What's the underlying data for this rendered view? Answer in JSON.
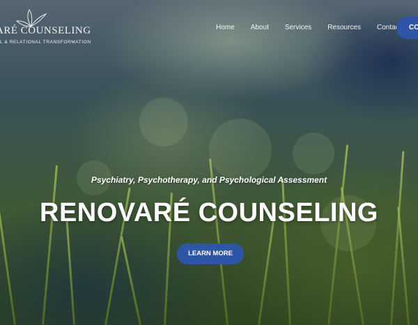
{
  "brand": {
    "name": "RENOVARÉ COUNSELING",
    "logo_name": "ARÉ COUNSELING",
    "logo_tagline": "L & RELATIONAL TRANSFORMATION"
  },
  "nav": {
    "items": [
      "Home",
      "About",
      "Services",
      "Resources",
      "Contact"
    ],
    "cta_label": "CO"
  },
  "hero": {
    "subtitle": "Psychiatry, Psychotherapy, and Psychological Assessment",
    "title": "RENOVARÉ COUNSELING",
    "button_label": "LEARN MORE"
  },
  "colors": {
    "accent": "#2f56a6",
    "text": "#ffffff"
  }
}
